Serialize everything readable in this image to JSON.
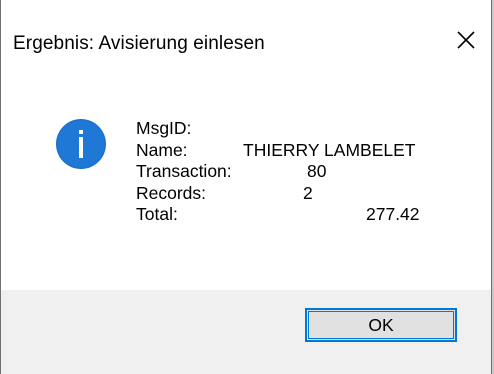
{
  "window": {
    "title": "Ergebnis: Avisierung einlesen",
    "close_glyph": "✕"
  },
  "message": {
    "icon": "info-icon",
    "fields": [
      {
        "label": "MsgID:",
        "value": ""
      },
      {
        "label": "Name:",
        "value": "THIERRY LAMBELET"
      },
      {
        "label": "Transaction:",
        "value": "80"
      },
      {
        "label": "Records:",
        "value": "2"
      },
      {
        "label": "Total:",
        "value": "277.42"
      }
    ]
  },
  "buttons": {
    "ok_label": "OK"
  },
  "colors": {
    "accent": "#0078d7",
    "footer_bg": "#f0f0f0",
    "button_bg": "#e1e1e1"
  }
}
